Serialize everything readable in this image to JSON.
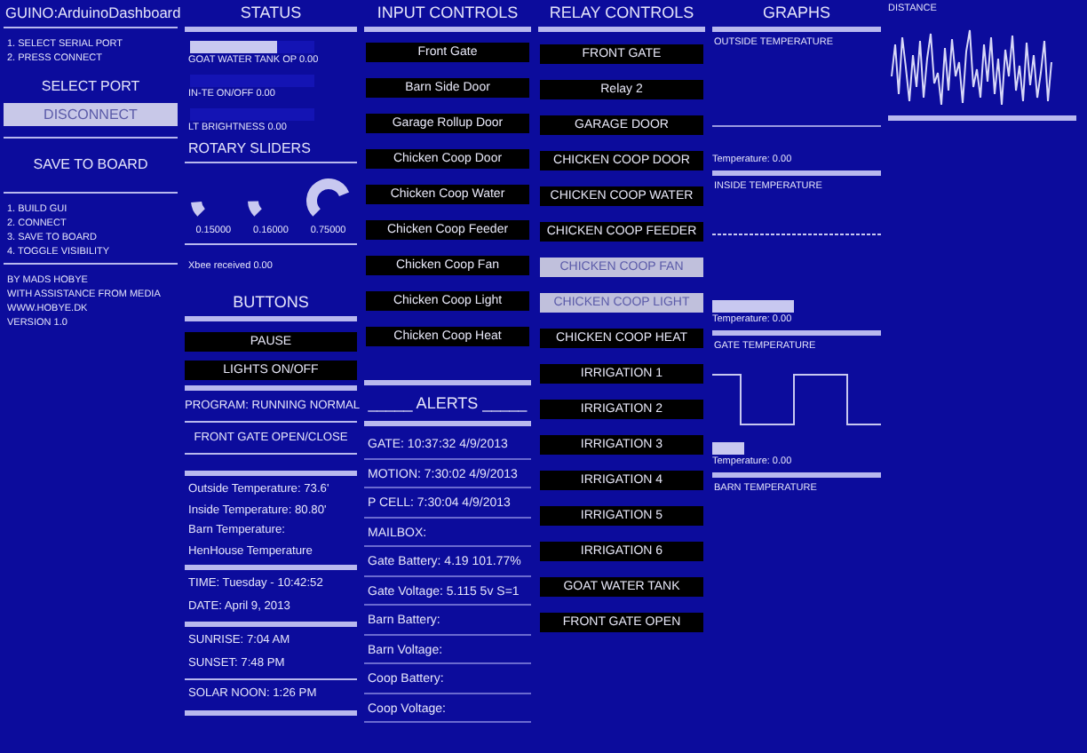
{
  "app": {
    "title": "GUINO:ArduinoDashboard"
  },
  "setup": {
    "steps": [
      "1. SELECT SERIAL PORT",
      "2. PRESS CONNECT"
    ],
    "buttons": [
      {
        "label": "SELECT PORT",
        "on": false
      },
      {
        "label": "DISCONNECT",
        "on": true
      }
    ],
    "save_button": "SAVE TO BOARD",
    "menu": [
      "1. BUILD GUI",
      "2. CONNECT",
      "3. SAVE TO BOARD",
      "4. TOGGLE VISIBILITY"
    ],
    "credits": [
      "BY MADS HOBYE",
      "WITH ASSISTANCE FROM MEDIA",
      "WWW.HOBYE.DK",
      "VERSION 1.0"
    ]
  },
  "status": {
    "title": "STATUS",
    "sliders": [
      {
        "label": "GOAT WATER TANK OP 0.00",
        "level": 0.7
      },
      {
        "label": "IN-TE ON/OFF 0.00",
        "level": 0
      },
      {
        "label": "LT BRIGHTNESS 0.00",
        "level": 0
      }
    ],
    "rotary_title": "ROTARY SLIDERS",
    "rotary": [
      {
        "reading": "0.15000"
      },
      {
        "reading": "0.16000"
      },
      {
        "reading": "0.75000"
      }
    ],
    "xbee": "Xbee received 0.00",
    "buttons_title": "BUTTONS",
    "buttons": [
      "PAUSE",
      "LIGHTS ON/OFF"
    ],
    "program": "PROGRAM: RUNNING NORMAL",
    "gate_action": "FRONT GATE OPEN/CLOSE",
    "temperatures": [
      "Outside Temperature:  73.6'",
      "Inside Temperature:  80.80'",
      "Barn Temperature:",
      "HenHouse Temperature"
    ],
    "time": [
      "TIME: Tuesday - 10:42:52",
      "DATE:  April 9, 2013"
    ],
    "sun": [
      "SUNRISE:  7:04 AM",
      "SUNSET:  7:48 PM"
    ],
    "solar_noon": "SOLAR NOON:  1:26 PM"
  },
  "inputs": {
    "title": "INPUT CONTROLS",
    "buttons": [
      "Front Gate",
      "Barn Side Door",
      "Garage Rollup Door",
      "Chicken Coop Door",
      "Chicken Coop Water",
      "Chicken Coop Feeder",
      "Chicken Coop Fan",
      "Chicken Coop Light",
      "Chicken Coop Heat"
    ]
  },
  "alerts": {
    "title": "_____ ALERTS _____",
    "lines": [
      "GATE:  10:37:32  4/9/2013",
      "MOTION:  7:30:02  4/9/2013",
      "P CELL:  7:30:04  4/9/2013",
      "MAILBOX:",
      "Gate Battery:  4.19  101.77%",
      "Gate Voltage:  5.115  5v  S=1",
      "Barn Battery:",
      "Barn Voltage:",
      "Coop Battery:",
      "Coop Voltage:"
    ]
  },
  "relays": {
    "title": "RELAY CONTROLS",
    "buttons": [
      {
        "label": "FRONT GATE",
        "on": false
      },
      {
        "label": "Relay 2",
        "on": false
      },
      {
        "label": "GARAGE DOOR",
        "on": false
      },
      {
        "label": "CHICKEN COOP DOOR",
        "on": false
      },
      {
        "label": "CHICKEN COOP WATER",
        "on": false
      },
      {
        "label": "CHICKEN COOP FEEDER",
        "on": false
      },
      {
        "label": "CHICKEN COOP FAN",
        "on": true
      },
      {
        "label": "CHICKEN COOP LIGHT",
        "on": true
      },
      {
        "label": "CHICKEN COOP HEAT",
        "on": false
      },
      {
        "label": "IRRIGATION 1",
        "on": false
      },
      {
        "label": "IRRIGATION 2",
        "on": false
      },
      {
        "label": "IRRIGATION 3",
        "on": false
      },
      {
        "label": "IRRIGATION 4",
        "on": false
      },
      {
        "label": "IRRIGATION 5",
        "on": false
      },
      {
        "label": "IRRIGATION 6",
        "on": false
      },
      {
        "label": "GOAT WATER TANK",
        "on": false
      },
      {
        "label": "FRONT GATE OPEN",
        "on": false
      }
    ]
  },
  "graphs": {
    "title": "GRAPHS",
    "panels": [
      {
        "title": "OUTSIDE TEMPERATURE",
        "kind": "flat",
        "reading": "Temperature: 0.00"
      },
      {
        "title": "INSIDE TEMPERATURE",
        "kind": "dashed",
        "reading": "Temperature: 0.00",
        "level": 0.65
      },
      {
        "title": "GATE TEMPERATURE",
        "kind": "square",
        "reading": "Temperature: 0.00",
        "level": 0.25
      },
      {
        "title": "BARN TEMPERATURE",
        "kind": "none"
      }
    ]
  },
  "distance": {
    "title": "DISTANCE"
  }
}
